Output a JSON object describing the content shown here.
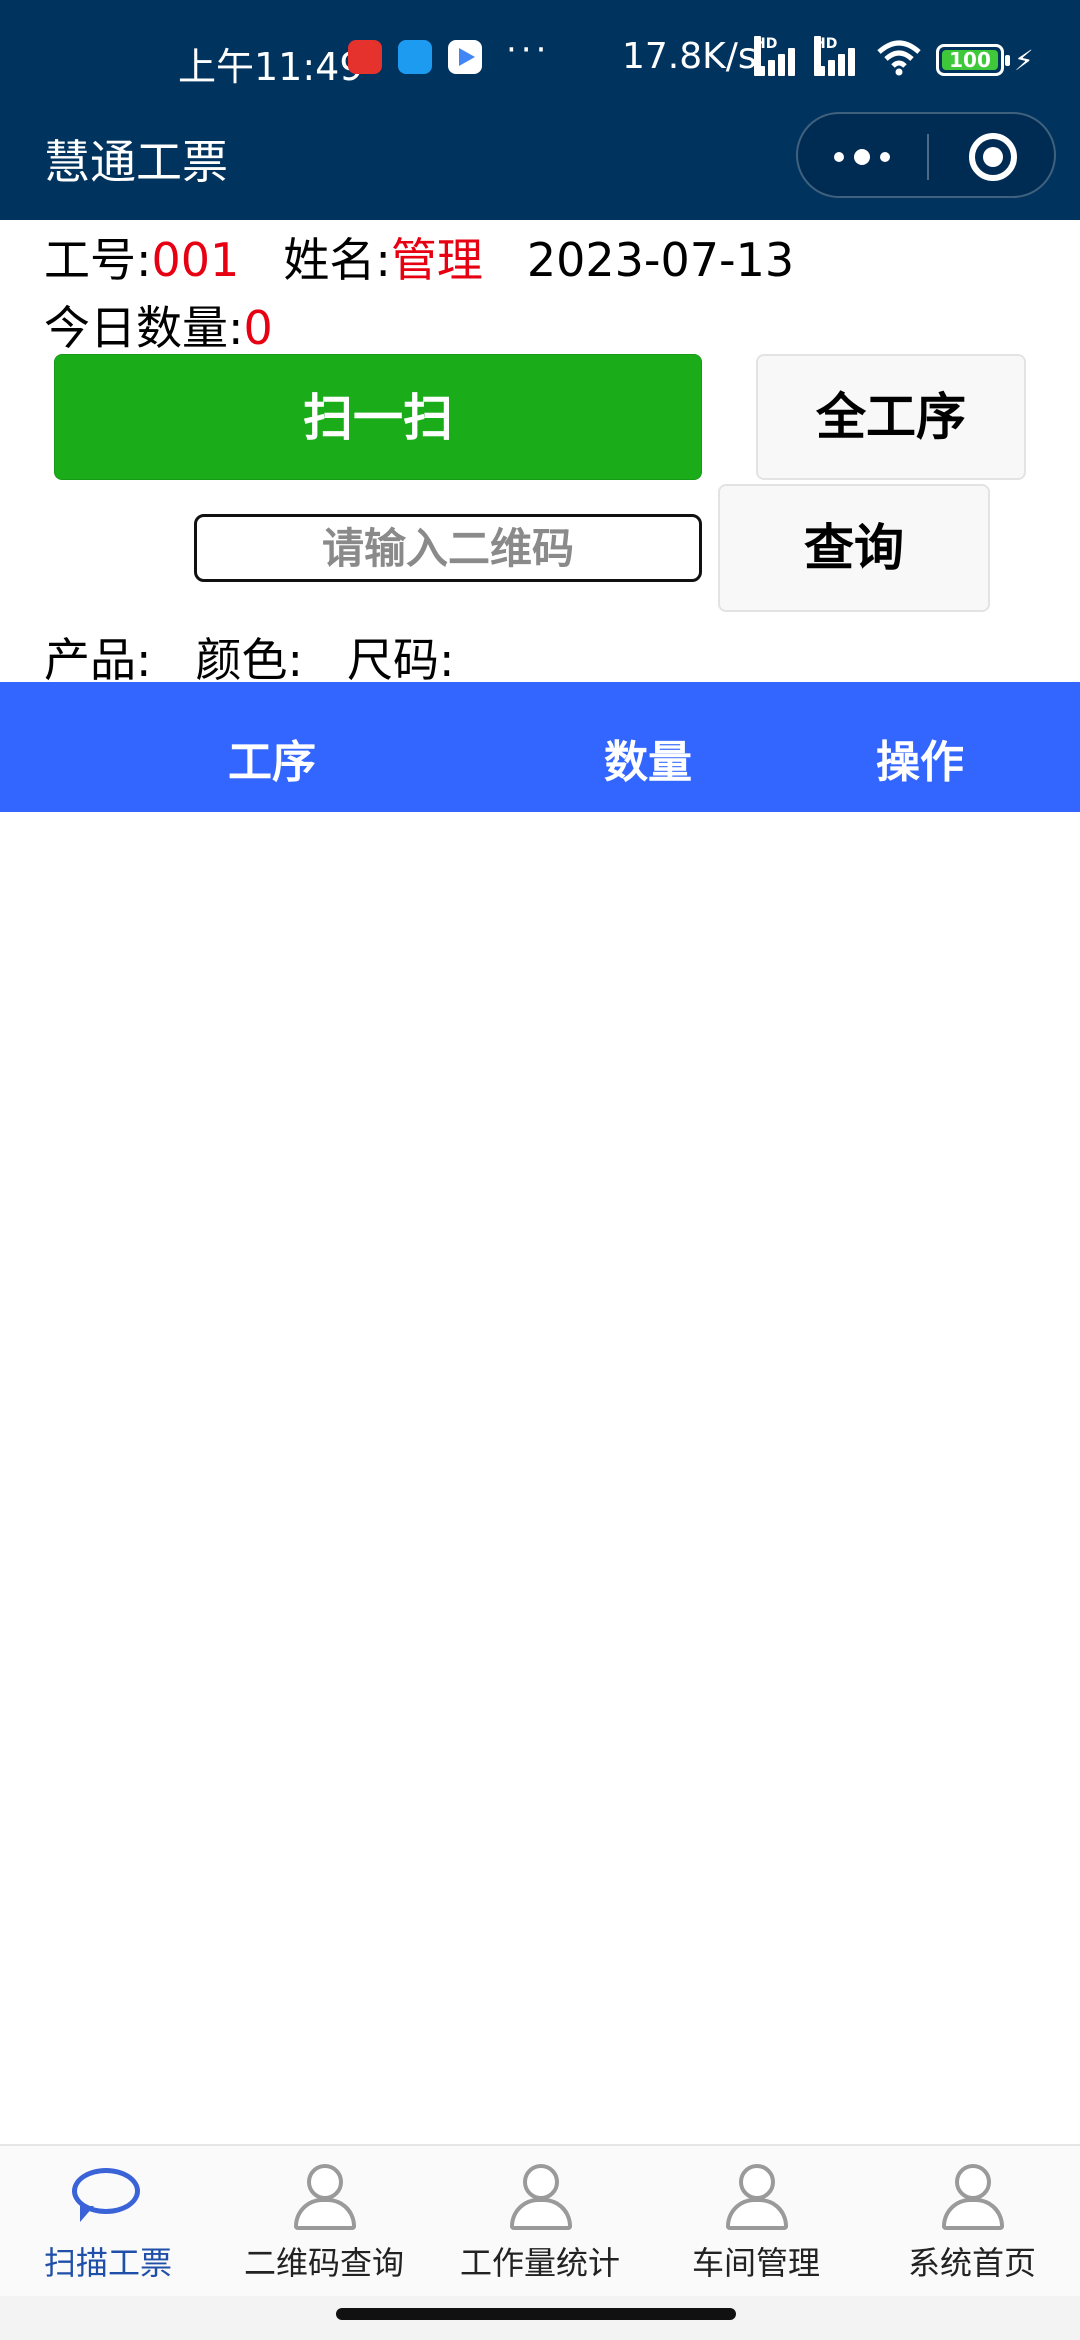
{
  "status_bar": {
    "time": "上午11:49",
    "dots": "···",
    "network_speed": "17.8K/s",
    "hd_label": "HD",
    "battery": "100",
    "bolt": "⚡"
  },
  "nav": {
    "title": "慧通工票"
  },
  "info": {
    "worker_id_label": "工号:",
    "worker_id": "001",
    "name_label": "姓名:",
    "name": "管理",
    "date": "2023-07-13",
    "today_qty_label": "今日数量:",
    "today_qty": "0"
  },
  "actions": {
    "scan_label": "扫一扫",
    "all_process_label": "全工序",
    "query_label": "查询",
    "qr_placeholder": "请输入二维码"
  },
  "product": {
    "product_label": "产品:",
    "color_label": "颜色:",
    "size_label": "尺码:"
  },
  "table": {
    "headers": [
      "工序",
      "数量",
      "操作"
    ]
  },
  "tabbar": {
    "items": [
      {
        "label": "扫描工票",
        "icon": "chat-bubble-icon"
      },
      {
        "label": "二维码查询",
        "icon": "person-icon"
      },
      {
        "label": "工作量统计",
        "icon": "person-icon"
      },
      {
        "label": "车间管理",
        "icon": "person-icon"
      },
      {
        "label": "系统首页",
        "icon": "person-icon"
      }
    ]
  },
  "colors": {
    "header_bg": "#01335f",
    "scan_button": "#1aad19",
    "table_header": "#3366ff",
    "accent_red": "#e60012",
    "active_tab": "#1f4fa8"
  }
}
